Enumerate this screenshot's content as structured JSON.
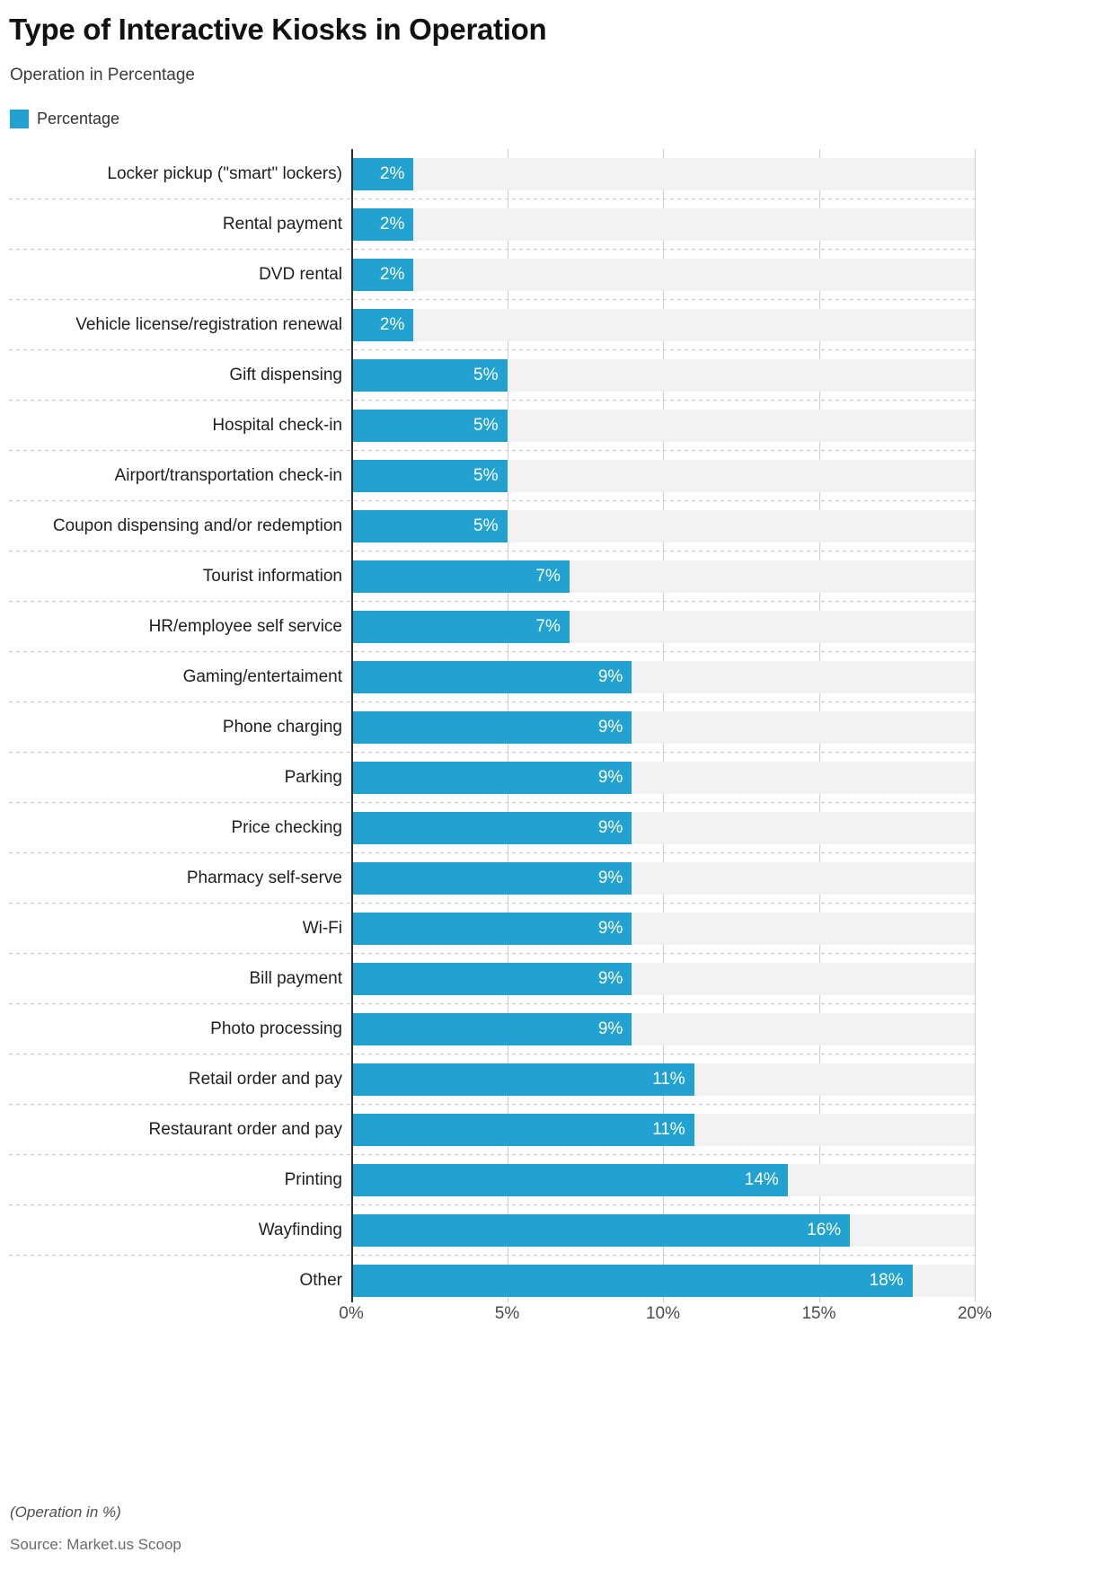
{
  "header": {
    "title": "Type of Interactive Kiosks in Operation",
    "subtitle": "Operation in Percentage"
  },
  "legend": {
    "items": [
      {
        "label": "Percentage",
        "color": "#22a2d0"
      }
    ]
  },
  "footer": {
    "note": "(Operation in %)",
    "source": "Source: Market.us Scoop"
  },
  "axis": {
    "ticks": [
      "0%",
      "5%",
      "10%",
      "15%",
      "20%"
    ],
    "tick_values": [
      0,
      5,
      10,
      15,
      20
    ]
  },
  "colors": {
    "bar": "#22a2d0",
    "track": "#f2f2f2",
    "axis_line": "#2b2b2b",
    "gridline": "#cfcfcf",
    "separator": "#c9c9c9",
    "title": "#111111",
    "value_label": "#ffffff"
  },
  "chart_data": {
    "type": "bar",
    "orientation": "horizontal",
    "title": "Type of Interactive Kiosks in Operation",
    "subtitle": "Operation in Percentage",
    "xlabel": "",
    "ylabel": "",
    "xlim": [
      0,
      20
    ],
    "grid": true,
    "legend_position": "top-left",
    "categories": [
      "Locker pickup (\"smart\" lockers)",
      "Rental payment",
      "DVD rental",
      "Vehicle license/registration renewal",
      "Gift dispensing",
      "Hospital check-in",
      "Airport/transportation check-in",
      "Coupon dispensing and/or redemption",
      "Tourist information",
      "HR/employee self service",
      "Gaming/entertaiment",
      "Phone charging",
      "Parking",
      "Price checking",
      "Pharmacy self-serve",
      "Wi-Fi",
      "Bill payment",
      "Photo processing",
      "Retail order and pay",
      "Restaurant order and pay",
      "Printing",
      "Wayfinding",
      "Other"
    ],
    "series": [
      {
        "name": "Percentage",
        "color": "#22a2d0",
        "values": [
          2,
          2,
          2,
          2,
          5,
          5,
          5,
          5,
          7,
          7,
          9,
          9,
          9,
          9,
          9,
          9,
          9,
          9,
          11,
          11,
          14,
          16,
          18
        ],
        "labels": [
          "2%",
          "2%",
          "2%",
          "2%",
          "5%",
          "5%",
          "5%",
          "5%",
          "7%",
          "7%",
          "9%",
          "9%",
          "9%",
          "9%",
          "9%",
          "9%",
          "9%",
          "9%",
          "11%",
          "11%",
          "14%",
          "16%",
          "18%"
        ]
      }
    ]
  }
}
